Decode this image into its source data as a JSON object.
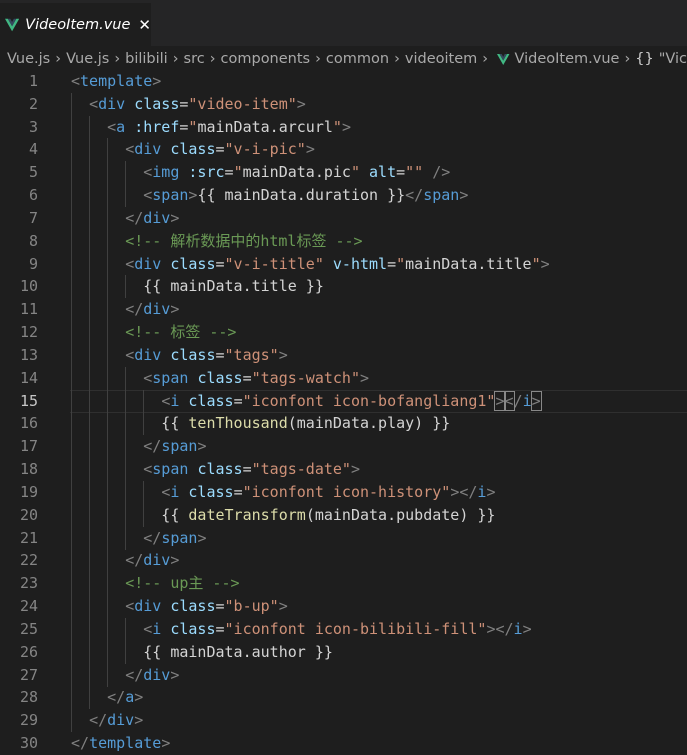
{
  "colors": {
    "background": "#1e1e1e",
    "tabbar": "#252526",
    "vue_green": "#41b883",
    "tag": "#569cd6",
    "attribute": "#9cdcfe",
    "string": "#ce9178",
    "comment": "#6a9955",
    "function": "#dcdcaa",
    "bracket": "#808080"
  },
  "tab": {
    "icon": "vue-file-icon",
    "title": "VideoItem.vue",
    "close": "✕"
  },
  "breadcrumb": {
    "items": [
      "Vue.js",
      "Vue.js",
      "bilibili",
      "src",
      "components",
      "common",
      "videoitem"
    ],
    "file": "VideoItem.vue",
    "symbol_icon": "{}",
    "symbol": "\"Vic"
  },
  "editor": {
    "current_line": 15,
    "lines": [
      {
        "n": "1",
        "segs": [
          [
            "t-br",
            "<"
          ],
          [
            "t-tag",
            "template"
          ],
          [
            "t-br",
            ">"
          ]
        ]
      },
      {
        "n": "2",
        "segs": [
          [
            "t-txt",
            "  "
          ],
          [
            "t-br",
            "<"
          ],
          [
            "t-tag",
            "div"
          ],
          [
            "t-txt",
            " "
          ],
          [
            "t-attr",
            "class"
          ],
          [
            "t-txt",
            "="
          ],
          [
            "t-str",
            "\"video-item\""
          ],
          [
            "t-br",
            ">"
          ]
        ]
      },
      {
        "n": "3",
        "segs": [
          [
            "t-txt",
            "    "
          ],
          [
            "t-br",
            "<"
          ],
          [
            "t-tag",
            "a"
          ],
          [
            "t-txt",
            " "
          ],
          [
            "t-attr",
            ":href"
          ],
          [
            "t-txt",
            "="
          ],
          [
            "t-str",
            "\""
          ],
          [
            "t-txt",
            "mainData.arcurl"
          ],
          [
            "t-str",
            "\""
          ],
          [
            "t-br",
            ">"
          ]
        ]
      },
      {
        "n": "4",
        "segs": [
          [
            "t-txt",
            "      "
          ],
          [
            "t-br",
            "<"
          ],
          [
            "t-tag",
            "div"
          ],
          [
            "t-txt",
            " "
          ],
          [
            "t-attr",
            "class"
          ],
          [
            "t-txt",
            "="
          ],
          [
            "t-str",
            "\"v-i-pic\""
          ],
          [
            "t-br",
            ">"
          ]
        ]
      },
      {
        "n": "5",
        "segs": [
          [
            "t-txt",
            "        "
          ],
          [
            "t-br",
            "<"
          ],
          [
            "t-tag",
            "img"
          ],
          [
            "t-txt",
            " "
          ],
          [
            "t-attr",
            ":src"
          ],
          [
            "t-txt",
            "="
          ],
          [
            "t-str",
            "\""
          ],
          [
            "t-txt",
            "mainData.pic"
          ],
          [
            "t-str",
            "\""
          ],
          [
            "t-txt",
            " "
          ],
          [
            "t-attr",
            "alt"
          ],
          [
            "t-txt",
            "="
          ],
          [
            "t-str",
            "\"\""
          ],
          [
            "t-txt",
            " "
          ],
          [
            "t-br",
            "/>"
          ]
        ]
      },
      {
        "n": "6",
        "segs": [
          [
            "t-txt",
            "        "
          ],
          [
            "t-br",
            "<"
          ],
          [
            "t-tag",
            "span"
          ],
          [
            "t-br",
            ">"
          ],
          [
            "t-txt",
            "{{ mainData.duration }}"
          ],
          [
            "t-br",
            "</"
          ],
          [
            "t-tag",
            "span"
          ],
          [
            "t-br",
            ">"
          ]
        ]
      },
      {
        "n": "7",
        "segs": [
          [
            "t-txt",
            "      "
          ],
          [
            "t-br",
            "</"
          ],
          [
            "t-tag",
            "div"
          ],
          [
            "t-br",
            ">"
          ]
        ]
      },
      {
        "n": "8",
        "segs": [
          [
            "t-txt",
            "      "
          ],
          [
            "t-com",
            "<!-- 解析数据中的html标签 -->"
          ]
        ]
      },
      {
        "n": "9",
        "segs": [
          [
            "t-txt",
            "      "
          ],
          [
            "t-br",
            "<"
          ],
          [
            "t-tag",
            "div"
          ],
          [
            "t-txt",
            " "
          ],
          [
            "t-attr",
            "class"
          ],
          [
            "t-txt",
            "="
          ],
          [
            "t-str",
            "\"v-i-title\""
          ],
          [
            "t-txt",
            " "
          ],
          [
            "t-attr",
            "v-html"
          ],
          [
            "t-txt",
            "="
          ],
          [
            "t-str",
            "\""
          ],
          [
            "t-txt",
            "mainData.title"
          ],
          [
            "t-str",
            "\""
          ],
          [
            "t-br",
            ">"
          ]
        ]
      },
      {
        "n": "10",
        "segs": [
          [
            "t-txt",
            "        {{ mainData.title }}"
          ]
        ]
      },
      {
        "n": "11",
        "segs": [
          [
            "t-txt",
            "      "
          ],
          [
            "t-br",
            "</"
          ],
          [
            "t-tag",
            "div"
          ],
          [
            "t-br",
            ">"
          ]
        ]
      },
      {
        "n": "12",
        "segs": [
          [
            "t-txt",
            "      "
          ],
          [
            "t-com",
            "<!-- 标签 -->"
          ]
        ]
      },
      {
        "n": "13",
        "segs": [
          [
            "t-txt",
            "      "
          ],
          [
            "t-br",
            "<"
          ],
          [
            "t-tag",
            "div"
          ],
          [
            "t-txt",
            " "
          ],
          [
            "t-attr",
            "class"
          ],
          [
            "t-txt",
            "="
          ],
          [
            "t-str",
            "\"tags\""
          ],
          [
            "t-br",
            ">"
          ]
        ]
      },
      {
        "n": "14",
        "segs": [
          [
            "t-txt",
            "        "
          ],
          [
            "t-br",
            "<"
          ],
          [
            "t-tag",
            "span"
          ],
          [
            "t-txt",
            " "
          ],
          [
            "t-attr",
            "class"
          ],
          [
            "t-txt",
            "="
          ],
          [
            "t-str",
            "\"tags-watch\""
          ],
          [
            "t-br",
            ">"
          ]
        ]
      },
      {
        "n": "15",
        "segs": [
          [
            "t-txt",
            "          "
          ],
          [
            "t-br",
            "<"
          ],
          [
            "t-tag",
            "i"
          ],
          [
            "t-txt",
            " "
          ],
          [
            "t-attr",
            "class"
          ],
          [
            "t-txt",
            "="
          ],
          [
            "t-str",
            "\"iconfont icon-bofangliang1\""
          ],
          [
            "t-br t-bracketbox",
            ">"
          ],
          [
            "t-br t-bracketbox",
            "<"
          ],
          [
            "t-br",
            "/"
          ],
          [
            "t-tag",
            "i"
          ],
          [
            "t-br t-bracketbox",
            ">"
          ]
        ]
      },
      {
        "n": "16",
        "segs": [
          [
            "t-txt",
            "          {{ "
          ],
          [
            "t-fn",
            "tenThousand"
          ],
          [
            "t-txt",
            "(mainData.play) }}"
          ]
        ]
      },
      {
        "n": "17",
        "segs": [
          [
            "t-txt",
            "        "
          ],
          [
            "t-br",
            "</"
          ],
          [
            "t-tag",
            "span"
          ],
          [
            "t-br",
            ">"
          ]
        ]
      },
      {
        "n": "18",
        "segs": [
          [
            "t-txt",
            "        "
          ],
          [
            "t-br",
            "<"
          ],
          [
            "t-tag",
            "span"
          ],
          [
            "t-txt",
            " "
          ],
          [
            "t-attr",
            "class"
          ],
          [
            "t-txt",
            "="
          ],
          [
            "t-str",
            "\"tags-date\""
          ],
          [
            "t-br",
            ">"
          ]
        ]
      },
      {
        "n": "19",
        "segs": [
          [
            "t-txt",
            "          "
          ],
          [
            "t-br",
            "<"
          ],
          [
            "t-tag",
            "i"
          ],
          [
            "t-txt",
            " "
          ],
          [
            "t-attr",
            "class"
          ],
          [
            "t-txt",
            "="
          ],
          [
            "t-str",
            "\"iconfont icon-history\""
          ],
          [
            "t-br",
            "></"
          ],
          [
            "t-tag",
            "i"
          ],
          [
            "t-br",
            ">"
          ]
        ]
      },
      {
        "n": "20",
        "segs": [
          [
            "t-txt",
            "          {{ "
          ],
          [
            "t-fn",
            "dateTransform"
          ],
          [
            "t-txt",
            "(mainData.pubdate) }}"
          ]
        ]
      },
      {
        "n": "21",
        "segs": [
          [
            "t-txt",
            "        "
          ],
          [
            "t-br",
            "</"
          ],
          [
            "t-tag",
            "span"
          ],
          [
            "t-br",
            ">"
          ]
        ]
      },
      {
        "n": "22",
        "segs": [
          [
            "t-txt",
            "      "
          ],
          [
            "t-br",
            "</"
          ],
          [
            "t-tag",
            "div"
          ],
          [
            "t-br",
            ">"
          ]
        ]
      },
      {
        "n": "23",
        "segs": [
          [
            "t-txt",
            "      "
          ],
          [
            "t-com",
            "<!-- up主 -->"
          ]
        ]
      },
      {
        "n": "24",
        "segs": [
          [
            "t-txt",
            "      "
          ],
          [
            "t-br",
            "<"
          ],
          [
            "t-tag",
            "div"
          ],
          [
            "t-txt",
            " "
          ],
          [
            "t-attr",
            "class"
          ],
          [
            "t-txt",
            "="
          ],
          [
            "t-str",
            "\"b-up\""
          ],
          [
            "t-br",
            ">"
          ]
        ]
      },
      {
        "n": "25",
        "segs": [
          [
            "t-txt",
            "        "
          ],
          [
            "t-br",
            "<"
          ],
          [
            "t-tag",
            "i"
          ],
          [
            "t-txt",
            " "
          ],
          [
            "t-attr",
            "class"
          ],
          [
            "t-txt",
            "="
          ],
          [
            "t-str",
            "\"iconfont icon-bilibili-fill\""
          ],
          [
            "t-br",
            "></"
          ],
          [
            "t-tag",
            "i"
          ],
          [
            "t-br",
            ">"
          ]
        ]
      },
      {
        "n": "26",
        "segs": [
          [
            "t-txt",
            "        {{ mainData.author }}"
          ]
        ]
      },
      {
        "n": "27",
        "segs": [
          [
            "t-txt",
            "      "
          ],
          [
            "t-br",
            "</"
          ],
          [
            "t-tag",
            "div"
          ],
          [
            "t-br",
            ">"
          ]
        ]
      },
      {
        "n": "28",
        "segs": [
          [
            "t-txt",
            "    "
          ],
          [
            "t-br",
            "</"
          ],
          [
            "t-tag",
            "a"
          ],
          [
            "t-br",
            ">"
          ]
        ]
      },
      {
        "n": "29",
        "segs": [
          [
            "t-txt",
            "  "
          ],
          [
            "t-br",
            "</"
          ],
          [
            "t-tag",
            "div"
          ],
          [
            "t-br",
            ">"
          ]
        ]
      },
      {
        "n": "30",
        "segs": [
          [
            "t-br",
            "</"
          ],
          [
            "t-tag",
            "template"
          ],
          [
            "t-br",
            ">"
          ]
        ]
      }
    ]
  }
}
